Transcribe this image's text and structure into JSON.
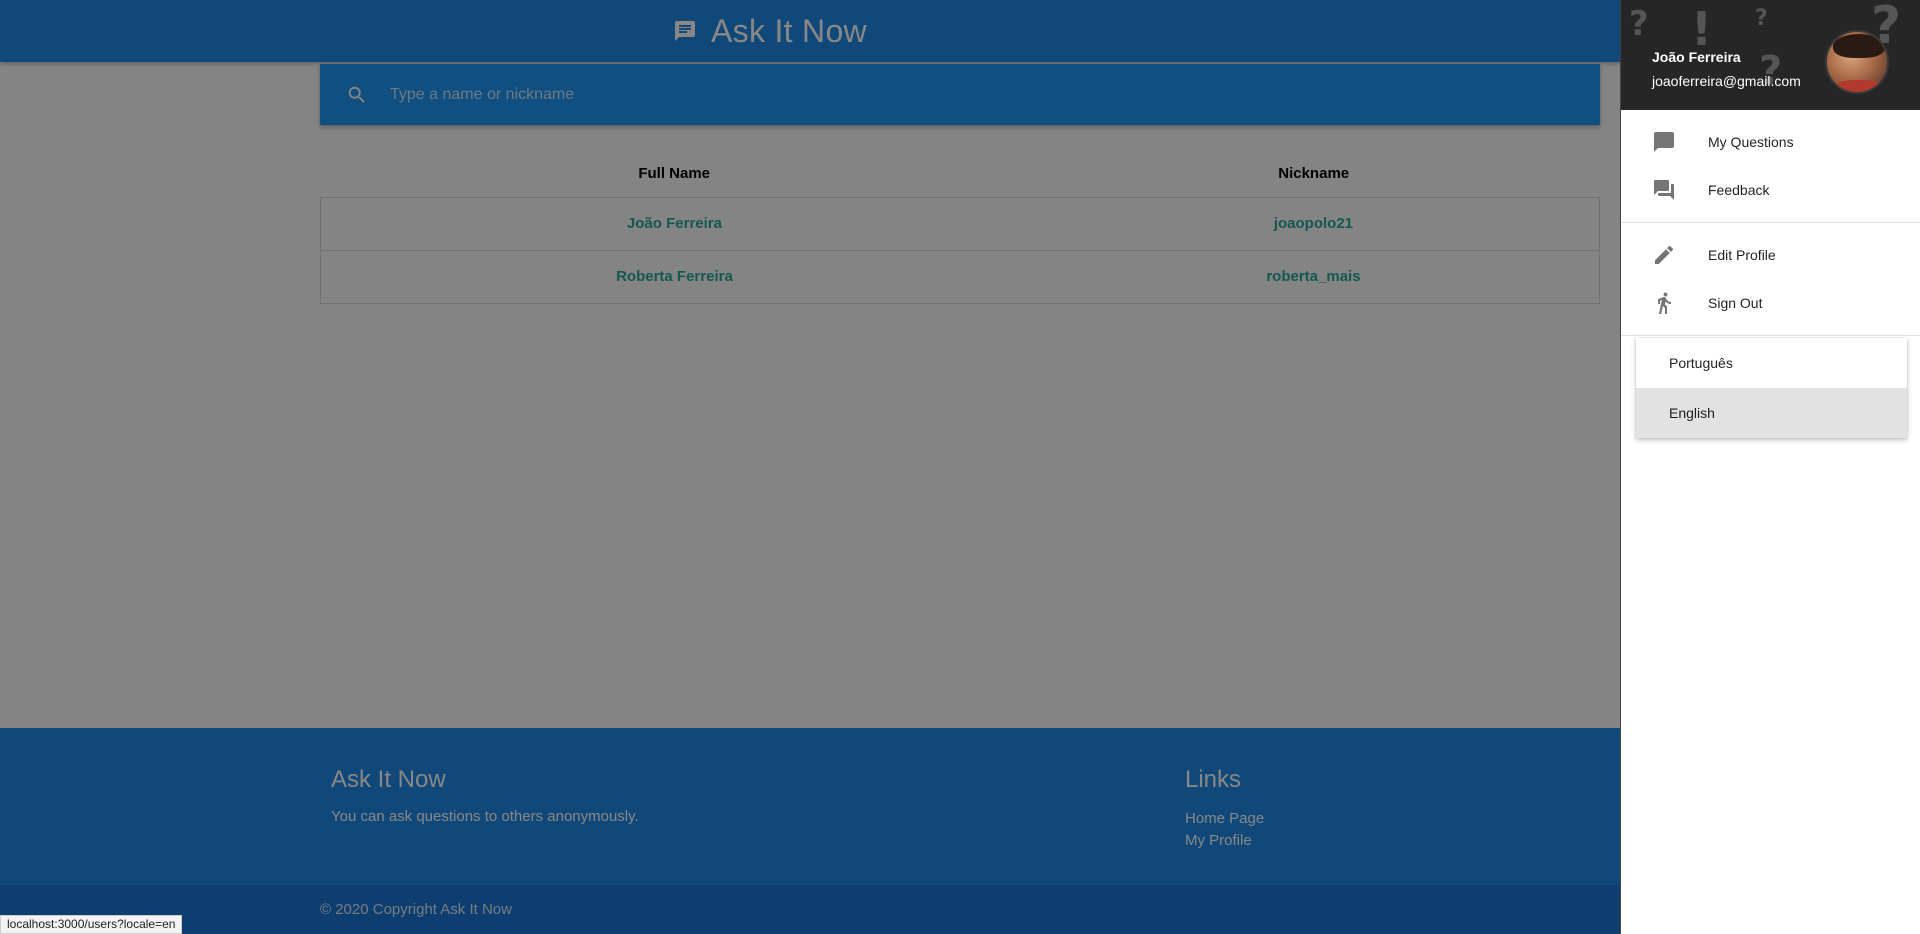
{
  "app": {
    "title": "Ask It Now",
    "brand_color": "#1e88e5",
    "accent_color": "#26a69a"
  },
  "search": {
    "placeholder": "Type a name or nickname",
    "icon": "search-icon"
  },
  "table": {
    "headers": [
      "Full Name",
      "Nickname"
    ],
    "rows": [
      {
        "full_name": "João Ferreira",
        "nickname": "joaopolo21"
      },
      {
        "full_name": "Roberta Ferreira",
        "nickname": "roberta_mais"
      }
    ]
  },
  "footer": {
    "about_title": "Ask It Now",
    "about_text": "You can ask questions to others anonymously.",
    "links_title": "Links",
    "links": [
      "Home Page",
      "My Profile"
    ],
    "copyright": "© 2020 Copyright Ask It Now"
  },
  "status_bar": {
    "url": "localhost:3000/users?locale=en"
  },
  "sidenav": {
    "user": {
      "name": "João Ferreira",
      "email": "joaoferreira@gmail.com"
    },
    "menu": [
      {
        "label": "My Questions",
        "icon": "chat-bubble-icon"
      },
      {
        "label": "Feedback",
        "icon": "forum-icon"
      },
      {
        "label": "Edit Profile",
        "icon": "pencil-icon"
      },
      {
        "label": "Sign Out",
        "icon": "walking-person-icon"
      }
    ],
    "languages": [
      {
        "label": "Português",
        "selected": false
      },
      {
        "label": "English",
        "selected": true
      }
    ]
  }
}
